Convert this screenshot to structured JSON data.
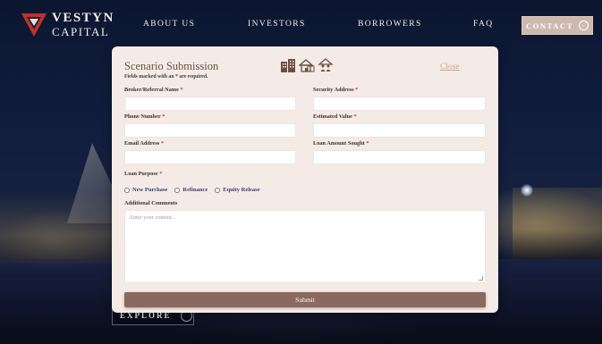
{
  "brand": {
    "line1": "VESTYN",
    "line2": "CAPITAL",
    "accent_color": "#c0312b"
  },
  "nav": {
    "items": [
      "ABOUT US",
      "INVESTORS",
      "BORROWERS",
      "FAQ"
    ],
    "contact_label": "CONTACT"
  },
  "hero": {
    "explore_label": "EXPLORE"
  },
  "modal": {
    "title": "Scenario Submission",
    "subtitle": "Fields marked with an * are required.",
    "close_label": "Close",
    "icons": [
      "building-icon",
      "house-icon",
      "family-home-icon"
    ],
    "fields": {
      "broker_name": "Broker/Referral Name",
      "security_address": "Security Address",
      "phone": "Phone Number",
      "estimated_value": "Estimated Value",
      "email": "Email Address",
      "loan_amount": "Loan Amount Sought",
      "loan_purpose": "Loan Purpose",
      "additional_comments": "Additional Comments"
    },
    "required_marker": "*",
    "loan_purpose_options": [
      "New Purchase",
      "Refinance",
      "Equity Release"
    ],
    "comments_placeholder": "Enter your content...",
    "submit_label": "Submit"
  }
}
